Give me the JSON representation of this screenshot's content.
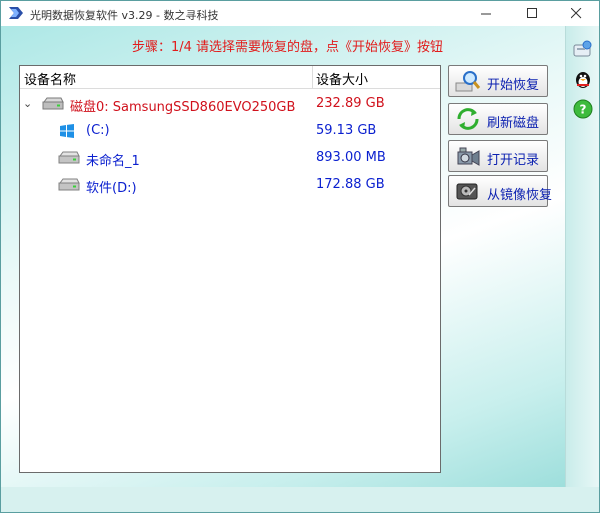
{
  "window": {
    "title": "光明数据恢复软件 v3.29 - 数之寻科技"
  },
  "step_text": "步骤：1/4 请选择需要恢复的盘，点《开始恢复》按钮",
  "tree": {
    "columns": {
      "name": "设备名称",
      "size": "设备大小"
    },
    "rows": [
      {
        "name": "磁盘0: SamsungSSD860EVO250GB",
        "size": "232.89 GB",
        "icon": "hard-disk-icon"
      },
      {
        "name": "(C:)",
        "size": "59.13 GB",
        "icon": "windows-logo-icon"
      },
      {
        "name": "未命名_1",
        "size": "893.00 MB",
        "icon": "drive-icon"
      },
      {
        "name": "软件(D:)",
        "size": "172.88 GB",
        "icon": "drive-icon"
      }
    ]
  },
  "buttons": {
    "start": "开始恢复",
    "refresh": "刷新磁盘",
    "open_record": "打开记录",
    "from_image": "从镜像恢复"
  },
  "colors": {
    "accent_red": "#d0111c",
    "link_blue": "#0a1fcf"
  }
}
